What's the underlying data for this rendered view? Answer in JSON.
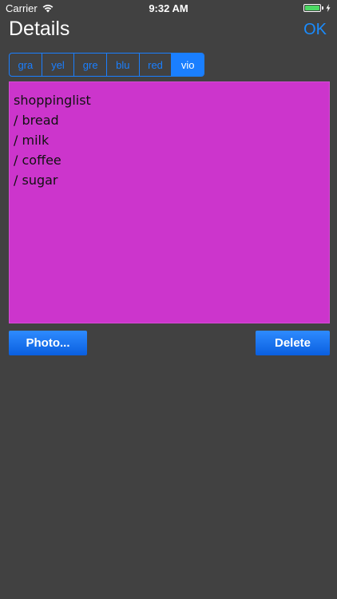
{
  "status_bar": {
    "carrier": "Carrier",
    "time": "9:32 AM",
    "battery_color": "#4cd964"
  },
  "nav": {
    "title": "Details",
    "ok_label": "OK"
  },
  "color_segments": {
    "items": [
      "gra",
      "yel",
      "gre",
      "blu",
      "red",
      "vio"
    ],
    "selected": "vio",
    "accent": "#1a7fff"
  },
  "note": {
    "background": "#cc35cc",
    "lines": [
      "shoppinglist",
      "/ bread",
      "/ milk",
      "/ coffee",
      "/ sugar"
    ]
  },
  "buttons": {
    "photo_label": "Photo...",
    "delete_label": "Delete"
  },
  "icons": [
    "wifi-icon",
    "battery-icon",
    "charging-bolt-icon"
  ]
}
